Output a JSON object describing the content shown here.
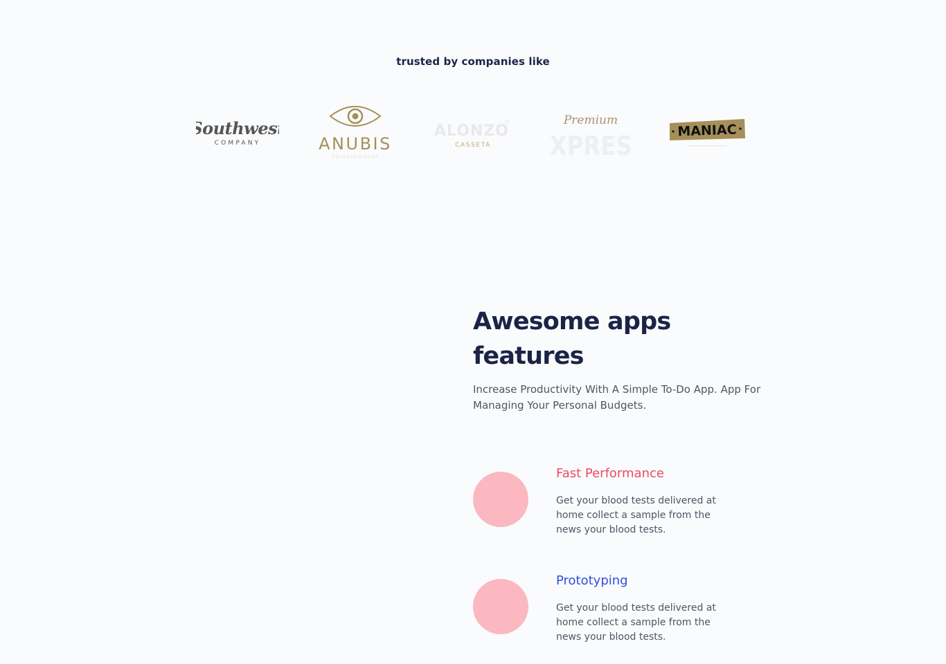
{
  "trusted": {
    "title": "trusted by companies like",
    "logos": [
      {
        "name": "Southwest",
        "sub": "COMPANY",
        "icon": "southwest-logo",
        "color": "#555555"
      },
      {
        "name": "ANUBIS",
        "sub": "ENTERTAINMENT",
        "icon": "anubis-eye-logo",
        "color": "#a68f5a"
      },
      {
        "name": "ALONZO",
        "sub": "CASSETA",
        "icon": "alonzo-logo",
        "color": "#c9a96a"
      },
      {
        "name": "EXPRESS",
        "sub": "Premium",
        "icon": "premium-express-logo",
        "color": "#a89373"
      },
      {
        "name": "MANIAC",
        "sub": "",
        "icon": "maniac-logo",
        "color": "#a68f5a"
      }
    ]
  },
  "features": {
    "heading_line1": "Awesome apps",
    "heading_line2": "features",
    "subtitle": "Increase Productivity With A Simple To-Do App. App For Managing Your Personal Budgets.",
    "items": [
      {
        "title": "Fast Performance",
        "title_color": "#ee4a5d",
        "description": "Get your blood tests delivered at home collect a sample from the news your blood tests.",
        "icon": "performance-icon"
      },
      {
        "title": "Prototyping",
        "title_color": "#2f4fe0",
        "description": "Get your blood tests delivered at home collect a sample from the news your blood tests.",
        "icon": "prototyping-icon"
      }
    ],
    "icon_color": "#fbb8c0"
  }
}
